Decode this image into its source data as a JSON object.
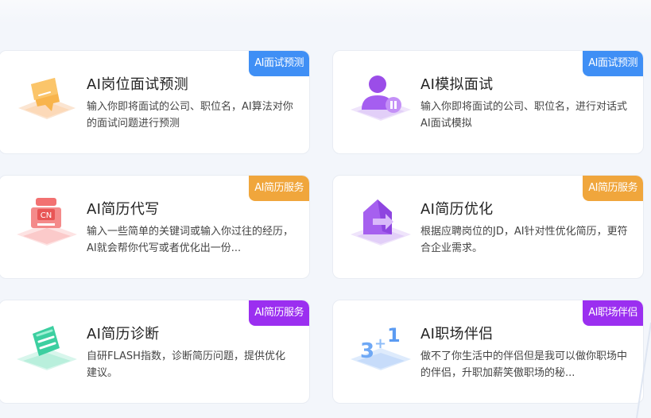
{
  "colors": {
    "blue_badge": "#3f8ff5",
    "orange_badge": "#f0a63c",
    "purple_badge": "#9b2ff0"
  },
  "cards": [
    {
      "title": "AI岗位面试预测",
      "desc": "输入你即将面试的公司、职位名，AI算法对你的面试问题进行预测",
      "badge": "AI面试预测",
      "badge_color": "#3f8ff5",
      "icon": "chat-bubble-icon"
    },
    {
      "title": "AI模拟面试",
      "desc": "输入你即将面试的公司、职位名，进行对话式AI面试模拟",
      "badge": "AI面试预测",
      "badge_color": "#3f8ff5",
      "icon": "user-pause-icon"
    },
    {
      "title": "AI简历代写",
      "desc": "输入一些简单的关键词或输入你过往的经历，AI就会帮你代写或者优化出一份...",
      "badge": "AI简历服务",
      "badge_color": "#f0a63c",
      "icon": "cn-document-icon"
    },
    {
      "title": "AI简历优化",
      "desc": "根据应聘岗位的JD，AI针对性优化简历，更符合企业需求。",
      "badge": "AI简历服务",
      "badge_color": "#f0a63c",
      "icon": "house-arrow-icon"
    },
    {
      "title": "AI简历诊断",
      "desc": "自研FLASH指数，诊断简历问题，提供优化建议。",
      "badge": "AI简历服务",
      "badge_color": "#9b2ff0",
      "icon": "document-check-icon"
    },
    {
      "title": "AI职场伴侣",
      "desc": "做不了你生活中的伴侣但是我可以做你职场中的伴侣，升职加薪笑傲职场的秘...",
      "badge": "AI职场伴侣",
      "badge_color": "#9b2ff0",
      "icon": "three-plus-one-icon"
    }
  ]
}
